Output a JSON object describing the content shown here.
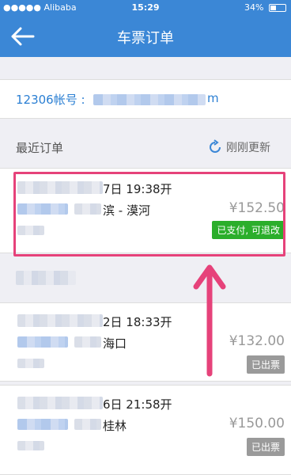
{
  "status_bar": {
    "carrier": "●●●●● Alibaba",
    "time": "15:29",
    "battery": "34%"
  },
  "header": {
    "title": "车票订单"
  },
  "account": {
    "label": "12306帐号 :",
    "tail": "m"
  },
  "recent": {
    "title": "最近订单",
    "refresh": "刚刚更新"
  },
  "orders": [
    {
      "datetime": "7日 19:38开",
      "route": "滨 - 漠河",
      "price": "¥152.50",
      "status": "已支付, 可退改"
    },
    {
      "datetime": "2日 18:33开",
      "route": "海口",
      "price": "¥132.00",
      "status": "已出票"
    },
    {
      "datetime": "6日 21:58开",
      "route": "桂林",
      "price": "¥150.00",
      "status": "已出票"
    }
  ],
  "colors": {
    "brand": "#3b87d6",
    "paid": "#2bae2b",
    "issued": "#9a9a9a",
    "highlight": "#e6427a"
  }
}
